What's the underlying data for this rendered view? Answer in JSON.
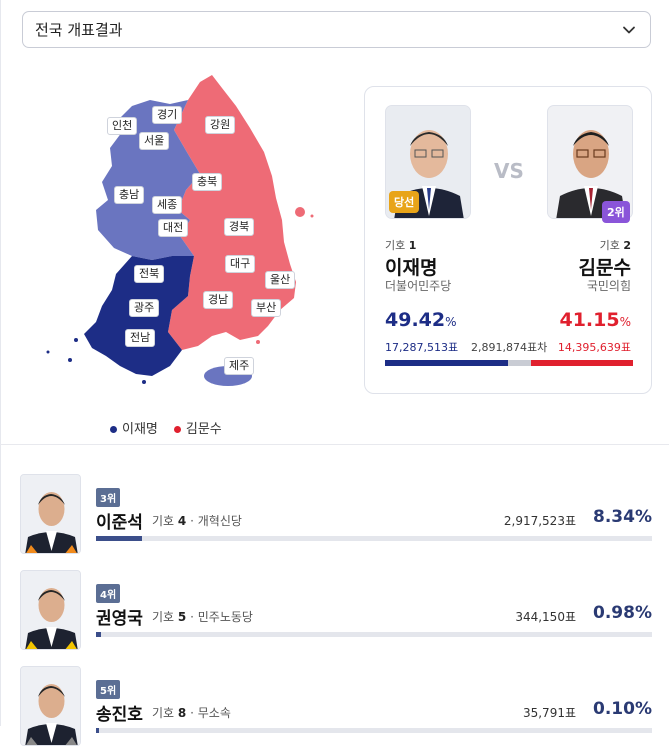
{
  "region_select": {
    "label": "전국 개표결과",
    "icon": "chevron-down-icon"
  },
  "map": {
    "labels": [
      "인천",
      "경기",
      "서울",
      "강원",
      "충남",
      "충북",
      "세종",
      "대전",
      "경북",
      "전북",
      "대구",
      "울산",
      "광주",
      "경남",
      "부산",
      "전남",
      "제주"
    ],
    "colors": {
      "lee": "#6a75c0",
      "lee_dark": "#1d2d86",
      "kim": "#ee6b76"
    }
  },
  "legend": [
    {
      "label": "이재명",
      "color": "#1d2d86"
    },
    {
      "label": "김문수",
      "color": "#e0202e"
    }
  ],
  "main_race": {
    "vs_label": "VS",
    "left": {
      "badge": "당선",
      "ballot_prefix": "기호",
      "ballot_no": "1",
      "name": "이재명",
      "party": "더불어민주당",
      "pct": "49.42",
      "pct_unit": "%",
      "votes": "17,287,513표",
      "color": "#1d2d86",
      "share": 49.42
    },
    "right": {
      "badge": "2위",
      "ballot_prefix": "기호",
      "ballot_no": "2",
      "name": "김문수",
      "party": "국민의힘",
      "pct": "41.15",
      "pct_unit": "%",
      "votes": "14,395,639표",
      "color": "#e0202e",
      "share": 41.15
    },
    "gap_label": "2,891,874표차"
  },
  "others": [
    {
      "rank": "3위",
      "name": "이준석",
      "ballot": "기호",
      "no": "4",
      "party": "· 개혁신당",
      "votes": "2,917,523표",
      "pct": "8.34%",
      "share": 8.34,
      "accent": "#f08a1c"
    },
    {
      "rank": "4위",
      "name": "권영국",
      "ballot": "기호",
      "no": "5",
      "party": "· 민주노동당",
      "votes": "344,150표",
      "pct": "0.98%",
      "share": 0.98,
      "accent": "#f2c500"
    },
    {
      "rank": "5위",
      "name": "송진호",
      "ballot": "기호",
      "no": "8",
      "party": "· 무소속",
      "votes": "35,791표",
      "pct": "0.10%",
      "share": 0.1,
      "accent": "#888888"
    }
  ]
}
